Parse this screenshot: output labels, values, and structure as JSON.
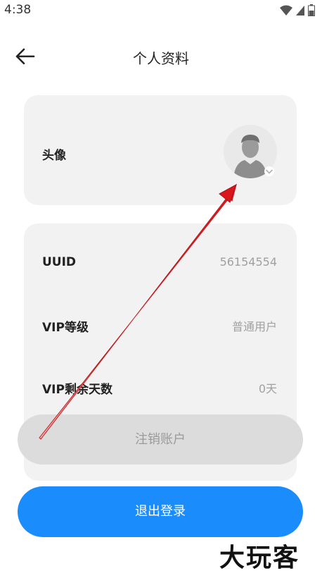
{
  "status_bar": {
    "time": "4:38",
    "icons": [
      "wifi-icon",
      "signal-icon",
      "battery-icon"
    ]
  },
  "header": {
    "title": "个人资料",
    "back_icon": "arrow-left-icon"
  },
  "avatar_section": {
    "label": "头像",
    "avatar_icon": "default-user-avatar-icon",
    "badge_icon": "chevron-down-icon"
  },
  "info_section": {
    "rows": [
      {
        "label": "UUID",
        "value": "56154554"
      },
      {
        "label": "VIP等级",
        "value": "普通用户"
      },
      {
        "label": "VIP剩余天数",
        "value": "0天"
      }
    ]
  },
  "actions": {
    "deactivate_label": "注销账户",
    "logout_label": "退出登录"
  },
  "colors": {
    "primary": "#1a8cfb",
    "card_bg": "#f2f2f2",
    "disabled_bg": "#dcdcdc",
    "annotation_arrow": "#e0191e"
  },
  "watermark": {
    "text": "大玩客"
  }
}
